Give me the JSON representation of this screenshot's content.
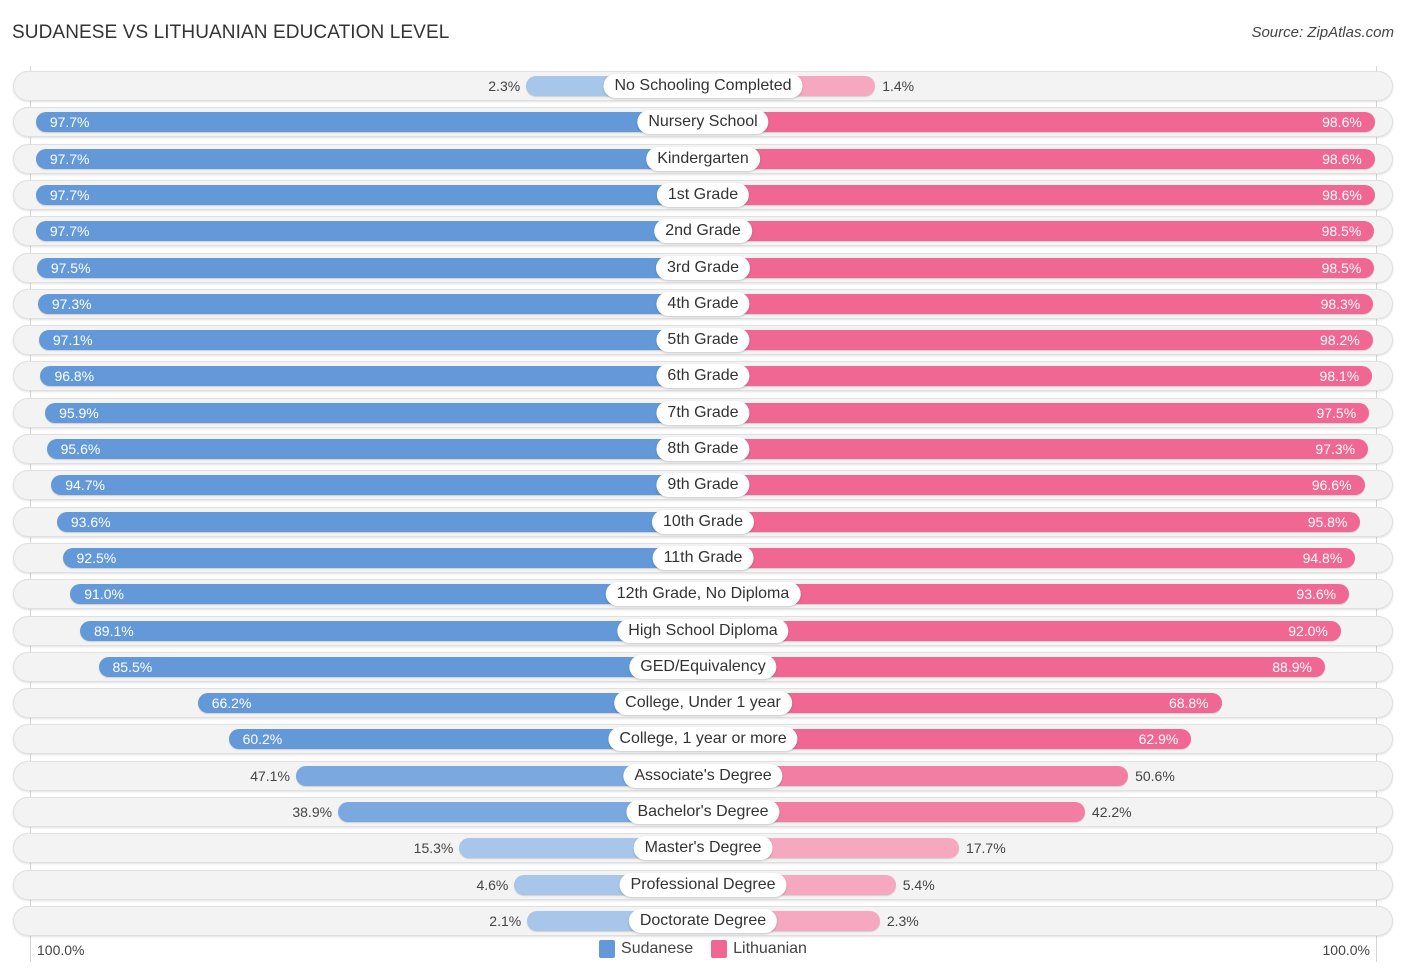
{
  "header": {
    "title": "SUDANESE VS LITHUANIAN EDUCATION LEVEL",
    "source": "Source: ZipAtlas.com"
  },
  "colors": {
    "sudanese": "#6399d9",
    "sudanese_light": "#a7c6ea",
    "lithuanian": "#f06794",
    "lithuanian_light": "#f6a8c1"
  },
  "chart_data": {
    "type": "bar",
    "orientation": "horizontal-diverging",
    "title": "SUDANESE VS LITHUANIAN EDUCATION LEVEL",
    "xlabel": "",
    "ylabel": "",
    "xlim": [
      0,
      100
    ],
    "axis_labels": {
      "left": "100.0%",
      "right": "100.0%"
    },
    "legend_position": "bottom-center",
    "categories": [
      "No Schooling Completed",
      "Nursery School",
      "Kindergarten",
      "1st Grade",
      "2nd Grade",
      "3rd Grade",
      "4th Grade",
      "5th Grade",
      "6th Grade",
      "7th Grade",
      "8th Grade",
      "9th Grade",
      "10th Grade",
      "11th Grade",
      "12th Grade, No Diploma",
      "High School Diploma",
      "GED/Equivalency",
      "College, Under 1 year",
      "College, 1 year or more",
      "Associate's Degree",
      "Bachelor's Degree",
      "Master's Degree",
      "Professional Degree",
      "Doctorate Degree"
    ],
    "series": [
      {
        "name": "Sudanese",
        "side": "left",
        "values": [
          2.3,
          97.7,
          97.7,
          97.7,
          97.7,
          97.5,
          97.3,
          97.1,
          96.8,
          95.9,
          95.6,
          94.7,
          93.6,
          92.5,
          91.0,
          89.1,
          85.5,
          66.2,
          60.2,
          47.1,
          38.9,
          15.3,
          4.6,
          2.1
        ],
        "labels": [
          "2.3%",
          "97.7%",
          "97.7%",
          "97.7%",
          "97.7%",
          "97.5%",
          "97.3%",
          "97.1%",
          "96.8%",
          "95.9%",
          "95.6%",
          "94.7%",
          "93.6%",
          "92.5%",
          "91.0%",
          "89.1%",
          "85.5%",
          "66.2%",
          "60.2%",
          "47.1%",
          "38.9%",
          "15.3%",
          "4.6%",
          "2.1%"
        ]
      },
      {
        "name": "Lithuanian",
        "side": "right",
        "values": [
          1.4,
          98.6,
          98.6,
          98.6,
          98.5,
          98.5,
          98.3,
          98.2,
          98.1,
          97.5,
          97.3,
          96.6,
          95.8,
          94.8,
          93.6,
          92.0,
          88.9,
          68.8,
          62.9,
          50.6,
          42.2,
          17.7,
          5.4,
          2.3
        ],
        "labels": [
          "1.4%",
          "98.6%",
          "98.6%",
          "98.6%",
          "98.5%",
          "98.5%",
          "98.3%",
          "98.2%",
          "98.1%",
          "97.5%",
          "97.3%",
          "96.6%",
          "95.8%",
          "94.8%",
          "93.6%",
          "92.0%",
          "88.9%",
          "68.8%",
          "62.9%",
          "50.6%",
          "42.2%",
          "17.7%",
          "5.4%",
          "2.3%"
        ]
      }
    ]
  },
  "legend": {
    "items": [
      {
        "name": "Sudanese"
      },
      {
        "name": "Lithuanian"
      }
    ]
  }
}
